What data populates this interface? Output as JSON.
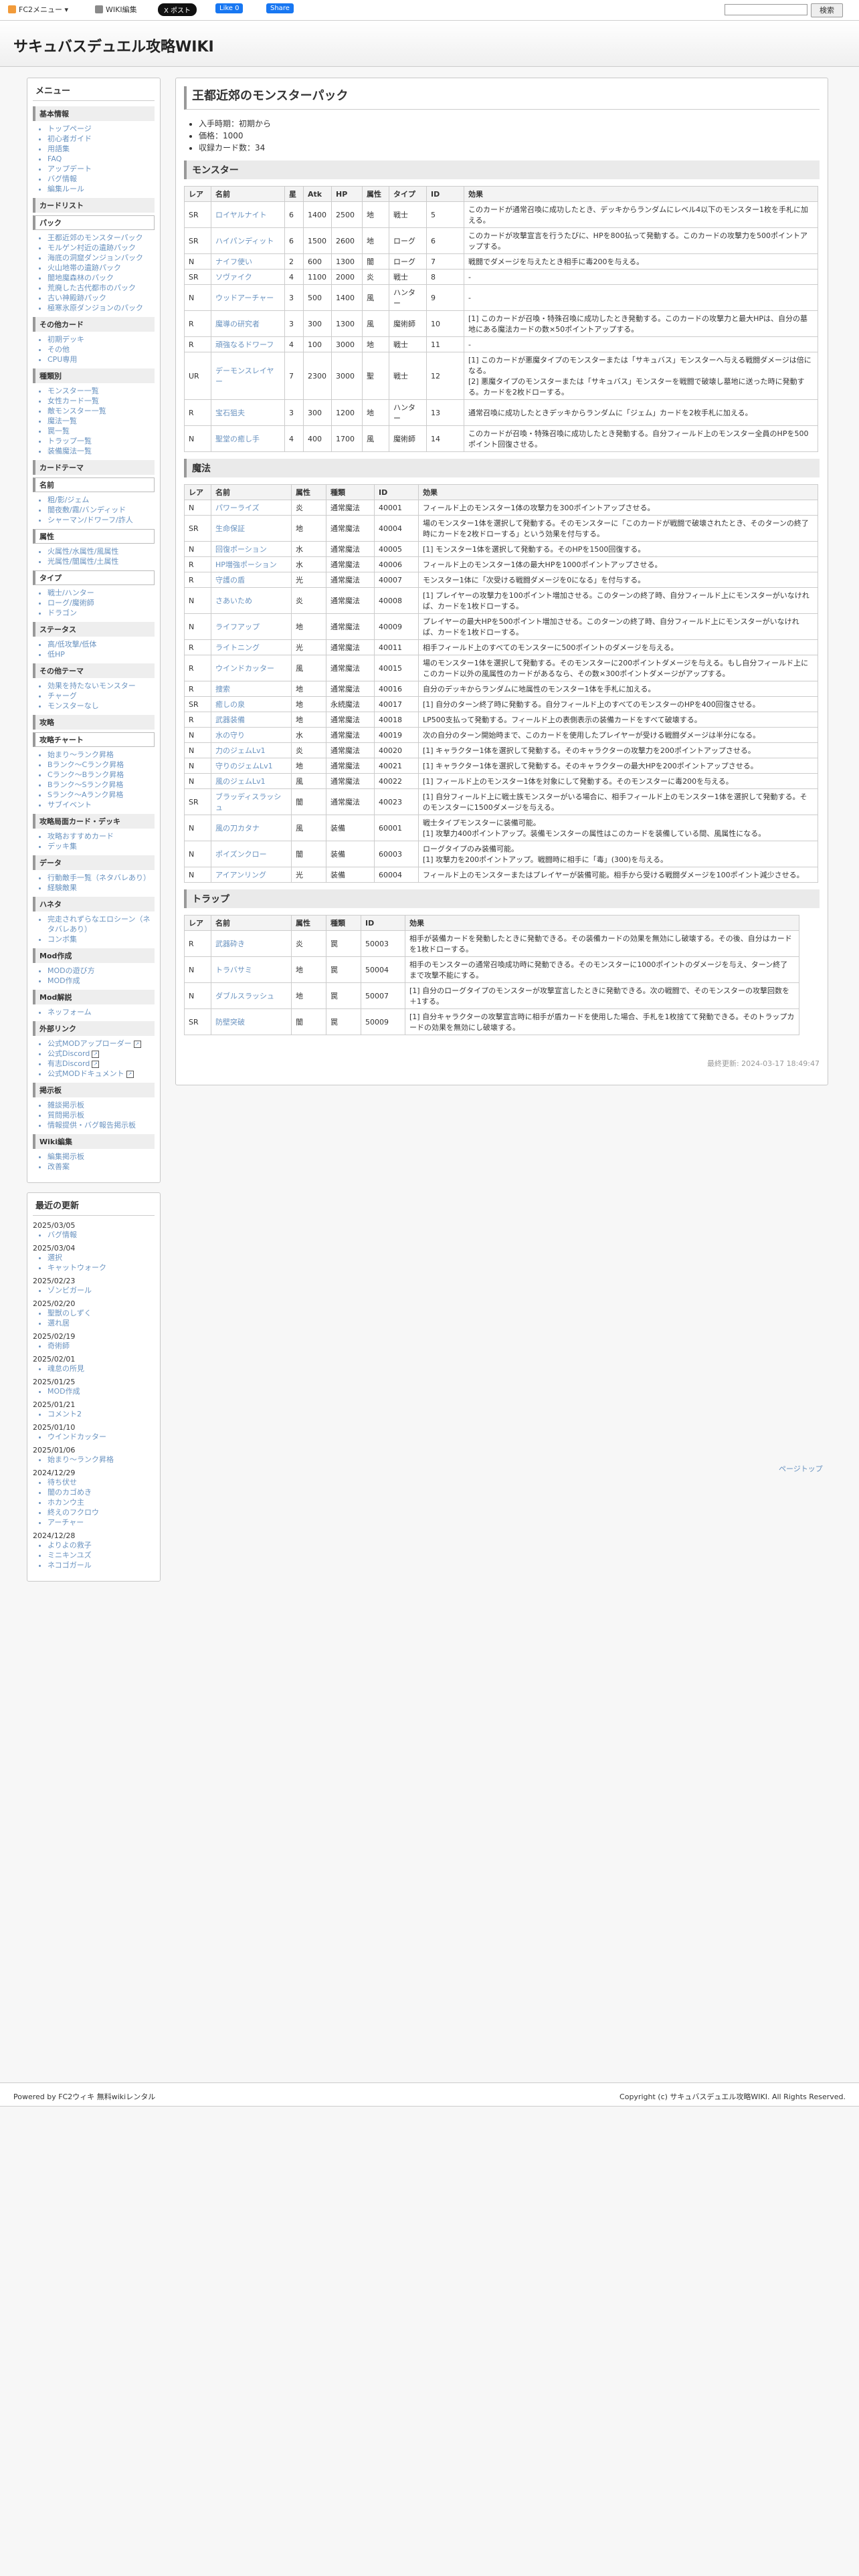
{
  "topbar": {
    "fc2_menu": "FC2メニュー ▾",
    "wiki_edit": "WIKI編集",
    "x_post": "X ポスト",
    "fb_like": "Like 0",
    "fb_share": "Share",
    "search_button": "検索"
  },
  "site_title": "サキュバスデュエル攻略WIKI",
  "page": {
    "title": "王都近郊のモンスターパック",
    "intro": [
      "入手時期：初期から",
      "価格：1000",
      "収録カード数：34"
    ],
    "updated": "最終更新: 2024-03-17 18:49:47",
    "pagetop": "ページトップ"
  },
  "monsters": {
    "heading": "モンスター",
    "headers": [
      "レア",
      "名前",
      "星",
      "Atk",
      "HP",
      "属性",
      "タイプ",
      "ID",
      "効果"
    ],
    "rows": [
      [
        "SR",
        "ロイヤルナイト",
        "6",
        "1400",
        "2500",
        "地",
        "戦士",
        "5",
        "このカードが通常召喚に成功したとき、デッキからランダムにレベル4以下のモンスター1枚を手札に加える。"
      ],
      [
        "SR",
        "ハイパンディット",
        "6",
        "1500",
        "2600",
        "地",
        "ローグ",
        "6",
        "このカードが攻撃宣言を行うたびに、HPを800払って発動する。このカードの攻撃力を500ポイントアップする。"
      ],
      [
        "N",
        "ナイフ使い",
        "2",
        "600",
        "1300",
        "闇",
        "ローグ",
        "7",
        "戦闘でダメージを与えたとき相手に毒200を与える。"
      ],
      [
        "SR",
        "ソヴァイク",
        "4",
        "1100",
        "2000",
        "炎",
        "戦士",
        "8",
        "-"
      ],
      [
        "N",
        "ウッドアーチャー",
        "3",
        "500",
        "1400",
        "風",
        "ハンター",
        "9",
        "-"
      ],
      [
        "R",
        "魔導の研究者",
        "3",
        "300",
        "1300",
        "風",
        "魔術師",
        "10",
        "[1] このカードが召喚・特殊召喚に成功したとき発動する。このカードの攻撃力と最大HPは、自分の墓地にある魔法カードの数×50ポイントアップする。"
      ],
      [
        "R",
        "頑強なるドワーフ",
        "4",
        "100",
        "3000",
        "地",
        "戦士",
        "11",
        "-"
      ],
      [
        "UR",
        "デーモンスレイヤー",
        "7",
        "2300",
        "3000",
        "聖",
        "戦士",
        "12",
        "[1] このカードが悪魔タイプのモンスターまたは「サキュバス」モンスターへ与える戦闘ダメージは倍になる。\n[2] 悪魔タイプのモンスターまたは「サキュバス」モンスターを戦闘で破壊し墓地に送った時に発動する。カードを2枚ドローする。"
      ],
      [
        "R",
        "宝石狙夫",
        "3",
        "300",
        "1200",
        "地",
        "ハンター",
        "13",
        "通常召喚に成功したときデッキからランダムに「ジェム」カードを2枚手札に加える。"
      ],
      [
        "N",
        "聖堂の癒し手",
        "4",
        "400",
        "1700",
        "風",
        "魔術師",
        "14",
        "このカードが召喚・特殊召喚に成功したとき発動する。自分フィールド上のモンスター全員のHPを500ポイント回復させる。"
      ]
    ]
  },
  "magic": {
    "heading": "魔法",
    "headers": [
      "レア",
      "名前",
      "属性",
      "種類",
      "ID",
      "効果"
    ],
    "rows": [
      [
        "N",
        "パワーライズ",
        "炎",
        "通常魔法",
        "40001",
        "フィールド上のモンスター1体の攻撃力を300ポイントアップさせる。"
      ],
      [
        "SR",
        "生命保証",
        "地",
        "通常魔法",
        "40004",
        "場のモンスター1体を選択して発動する。そのモンスターに「このカードが戦闘で破壊されたとき、そのターンの終了時にカードを2枚ドローする」という効果を付与する。"
      ],
      [
        "N",
        "回復ポーション",
        "水",
        "通常魔法",
        "40005",
        "[1] モンスター1体を選択して発動する。そのHPを1500回復する。"
      ],
      [
        "R",
        "HP増強ポーション",
        "水",
        "通常魔法",
        "40006",
        "フィールド上のモンスター1体の最大HPを1000ポイントアップさせる。"
      ],
      [
        "R",
        "守護の盾",
        "光",
        "通常魔法",
        "40007",
        "モンスター1体に「次受ける戦闘ダメージを0になる」を付与する。"
      ],
      [
        "N",
        "さあいため",
        "炎",
        "通常魔法",
        "40008",
        "[1] プレイヤーの攻撃力を100ポイント増加させる。このターンの終了時、自分フィールド上にモンスターがいなければ、カードを1枚ドローする。"
      ],
      [
        "N",
        "ライフアップ",
        "地",
        "通常魔法",
        "40009",
        "プレイヤーの最大HPを500ポイント増加させる。このターンの終了時、自分フィールド上にモンスターがいなければ、カードを1枚ドローする。"
      ],
      [
        "R",
        "ライトニング",
        "光",
        "通常魔法",
        "40011",
        "相手フィールド上のすべてのモンスターに500ポイントのダメージを与える。"
      ],
      [
        "R",
        "ウインドカッター",
        "風",
        "通常魔法",
        "40015",
        "場のモンスター1体を選択して発動する。そのモンスターに200ポイントダメージを与える。もし自分フィールド上にこのカード以外の風属性のカードがあるなら、その数×300ポイントダメージがアップする。"
      ],
      [
        "R",
        "捜索",
        "地",
        "通常魔法",
        "40016",
        "自分のデッキからランダムに地属性のモンスター1体を手札に加える。"
      ],
      [
        "SR",
        "癒しの泉",
        "地",
        "永続魔法",
        "40017",
        "[1] 自分のターン終了時に発動する。自分フィールド上のすべてのモンスターのHPを400回復させる。"
      ],
      [
        "R",
        "武器装備",
        "地",
        "通常魔法",
        "40018",
        "LP500支払って発動する。フィールド上の表側表示の装備カードをすべて破壊する。"
      ],
      [
        "N",
        "水の守り",
        "水",
        "通常魔法",
        "40019",
        "次の自分のターン開始時まで、このカードを使用したプレイヤーが受ける戦闘ダメージは半分になる。"
      ],
      [
        "N",
        "力のジェムLv1",
        "炎",
        "通常魔法",
        "40020",
        "[1] キャラクター1体を選択して発動する。そのキャラクターの攻撃力を200ポイントアップさせる。"
      ],
      [
        "N",
        "守りのジェムLv1",
        "地",
        "通常魔法",
        "40021",
        "[1] キャラクター1体を選択して発動する。そのキャラクターの最大HPを200ポイントアップさせる。"
      ],
      [
        "N",
        "風のジェムLv1",
        "風",
        "通常魔法",
        "40022",
        "[1] フィールド上のモンスター1体を対象にして発動する。そのモンスターに毒200を与える。"
      ],
      [
        "SR",
        "ブラッディスラッシュ",
        "闇",
        "通常魔法",
        "40023",
        "[1] 自分フィールド上に戦士族モンスターがいる場合に、相手フィールド上のモンスター1体を選択して発動する。そのモンスターに1500ダメージを与える。"
      ],
      [
        "N",
        "風の刀カタナ",
        "風",
        "装備",
        "60001",
        "戦士タイプモンスターに装備可能。\n[1] 攻撃力400ポイントアップ。装備モンスターの属性はこのカードを装備している間、風属性になる。"
      ],
      [
        "N",
        "ポイズンクロー",
        "闇",
        "装備",
        "60003",
        "ローグタイプのみ装備可能。\n[1] 攻撃力を200ポイントアップ。戦闘時に相手に「毒」(300)を与える。"
      ],
      [
        "N",
        "アイアンリング",
        "光",
        "装備",
        "60004",
        "フィールド上のモンスターまたはプレイヤーが装備可能。相手から受ける戦闘ダメージを100ポイント減少させる。"
      ]
    ]
  },
  "traps": {
    "heading": "トラップ",
    "headers": [
      "レア",
      "名前",
      "属性",
      "種類",
      "ID",
      "効果"
    ],
    "rows": [
      [
        "R",
        "武器砕き",
        "炎",
        "罠",
        "50003",
        "相手が装備カードを発動したときに発動できる。その装備カードの効果を無効にし破壊する。その後、自分はカードを1枚ドローする。"
      ],
      [
        "N",
        "トラバサミ",
        "地",
        "罠",
        "50004",
        "相手のモンスターの通常召喚成功時に発動できる。そのモンスターに1000ポイントのダメージを与え、ターン終了まで攻撃不能にする。"
      ],
      [
        "N",
        "ダブルスラッシュ",
        "地",
        "罠",
        "50007",
        "[1] 自分のローグタイプのモンスターが攻撃宣言したときに発動できる。次の戦闘で、そのモンスターの攻撃回数を＋1する。"
      ],
      [
        "SR",
        "防壁突破",
        "闇",
        "罠",
        "50009",
        "[1] 自分キャラクターの攻撃宣言時に相手が盾カードを使用した場合、手札を1枚捨てて発動できる。そのトラップカードの効果を無効にし破壊する。"
      ]
    ]
  },
  "sidebar": {
    "menu_title": "メニュー",
    "basic_title": "基本情報",
    "basic": [
      "トップページ",
      "初心者ガイド",
      "用語集",
      "FAQ",
      "アップデート",
      "バグ情報",
      "編集ルール"
    ],
    "cardlist_title": "カードリスト",
    "pack_title": "パック",
    "pack": [
      "王都近郊のモンスターパック",
      "モルゲン村近の遺跡パック",
      "海底の洞窟ダンジョンパック",
      "火山地帯の遺跡パック",
      "闇地魔森林のパック",
      "荒廃した古代都市のパック",
      "古い神殿跡パック",
      "極寒氷原ダンジョンのパック"
    ],
    "other_title": "その他カード",
    "other": [
      "初期デッキ",
      "その他",
      "CPU専用"
    ],
    "kind_title": "種類別",
    "kind": [
      "モンスター一覧",
      "女性カード一覧",
      "敵モンスター一覧",
      "魔法一覧",
      "罠一覧",
      "トラップ一覧",
      "装備魔法一覧"
    ],
    "theme_title": "カードテーマ",
    "name_title": "名前",
    "name": [
      "粗/影/ジェム",
      "闇夜敷/霧/バンディッド",
      "シャーマン/ドワーフ/詐人"
    ],
    "attr_title": "属性",
    "attr": [
      "火属性/水属性/風属性",
      "光属性/闇属性/土属性"
    ],
    "type_title": "タイプ",
    "type": [
      "戦士/ハンター",
      "ローグ/魔術師",
      "ドラゴン"
    ],
    "status_title": "ステータス",
    "status": [
      "高/低攻撃/低体",
      "低HP"
    ],
    "other2_title": "その他テーマ",
    "other2": [
      "効果を持たないモンスター",
      "チャーグ",
      "モンスターなし"
    ],
    "strategy_title": "攻略",
    "chart_title": "攻略チャート",
    "chart": [
      "始まり〜ランク昇格",
      "Bランク〜Cランク昇格",
      "Cランク〜Bランク昇格",
      "Bランク〜Sランク昇格",
      "Sランク〜Aランク昇格",
      "サブイベント"
    ],
    "deck_title": "攻略局面カード・デッキ",
    "deck": [
      "攻略おすすめカード",
      "デッキ集"
    ],
    "data_title": "データ",
    "data": [
      "行動敵手一覧（ネタバレあり）",
      "経験敵果"
    ],
    "neta_title": "ハネタ",
    "neta": [
      "完走されずらなエロシーン（ネタバレあり）",
      "コンボ集"
    ],
    "mod_title": "Mod作成",
    "mod": [
      "MODの遊び方",
      "MOD作成"
    ],
    "modguide_title": "Mod解説",
    "modguide": [
      "ネッフォーム"
    ],
    "ext_title": "外部リンク",
    "ext": [
      "公式MODアップローダー",
      "公式Discord",
      "有志Discord",
      "公式MODドキュメント"
    ],
    "board_title": "掲示板",
    "board": [
      "雑談掲示板",
      "質問掲示板",
      "情報提供・バグ報告掲示板"
    ],
    "wiki_title": "Wiki編集",
    "wiki": [
      "編集掲示板",
      "改善案"
    ]
  },
  "recent": {
    "title": "最近の更新",
    "groups": [
      {
        "date": "2025/03/05",
        "items": [
          "バグ情報"
        ]
      },
      {
        "date": "2025/03/04",
        "items": [
          "選択",
          "キャットウォーク"
        ]
      },
      {
        "date": "2025/02/23",
        "items": [
          "ゾンビガール"
        ]
      },
      {
        "date": "2025/02/20",
        "items": [
          "聖獣のしずく",
          "選れ居"
        ]
      },
      {
        "date": "2025/02/19",
        "items": [
          "奇術師"
        ]
      },
      {
        "date": "2025/02/01",
        "items": [
          "魂怠の所見"
        ]
      },
      {
        "date": "2025/01/25",
        "items": [
          "MOD作成"
        ]
      },
      {
        "date": "2025/01/21",
        "items": [
          "コメント2"
        ]
      },
      {
        "date": "2025/01/10",
        "items": [
          "ウインドカッター"
        ]
      },
      {
        "date": "2025/01/06",
        "items": [
          "始まり〜ランク昇格"
        ]
      },
      {
        "date": "2024/12/29",
        "items": [
          "待ち伏せ",
          "闇のカゴめき",
          "ホカンウ主",
          "終えのフクロウ",
          "アーチャー"
        ]
      },
      {
        "date": "2024/12/28",
        "items": [
          "よりよの救子",
          "ミニキンユズ",
          "ネコゴガール"
        ]
      }
    ]
  },
  "footer": {
    "left": "Powered by FC2ウィキ 無料wikiレンタル",
    "right": "Copyright (c) サキュバスデュエル攻略WIKI. All Rights Reserved."
  }
}
